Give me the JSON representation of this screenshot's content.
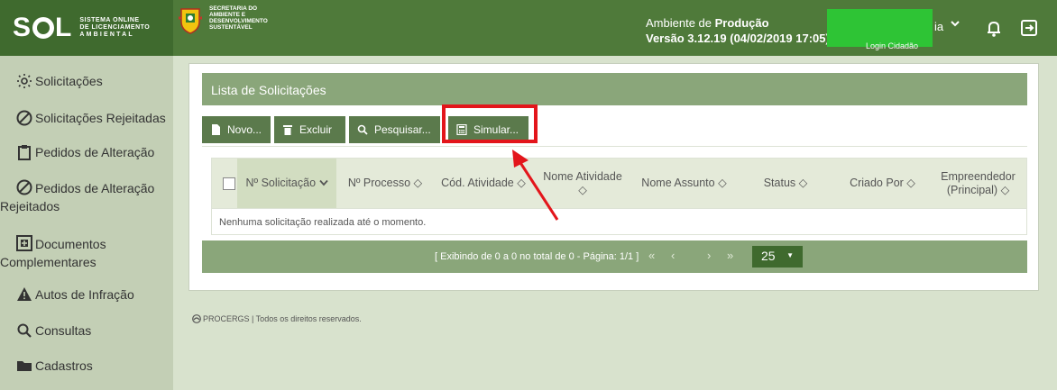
{
  "header": {
    "brand_sol": "SOL",
    "brand_line1": "SISTEMA ONLINE",
    "brand_line2": "DE LICENCIAMENTO",
    "brand_line3": "AMBIENTAL",
    "sec_line1": "SECRETARIA DO",
    "sec_line2": "AMBIENTE E",
    "sec_line3": "DESENVOLVIMENTO",
    "sec_line4": "SUSTENTÁVEL",
    "ambiente_prefix": "Ambiente de ",
    "ambiente_value": "Produção",
    "versao": "Versão 3.12.19 (04/02/2019 17:05)",
    "user_suffix": "ia",
    "login_label": "Login Cidadão"
  },
  "sidebar": {
    "items": [
      {
        "label": "Solicitações",
        "icon": "sun-icon"
      },
      {
        "label": "Solicitações Rejeitadas",
        "icon": "ban-icon"
      },
      {
        "label": "Pedidos de Alteração",
        "icon": "clipboard-icon"
      },
      {
        "label": "Pedidos de Alteração",
        "label2": "Rejeitados",
        "icon": "ban-icon"
      },
      {
        "label": "Documentos",
        "label2": "Complementares",
        "icon": "plus-square-icon"
      },
      {
        "label": "Autos de Infração",
        "icon": "warning-icon"
      },
      {
        "label": "Consultas",
        "icon": "search-icon"
      },
      {
        "label": "Cadastros",
        "icon": "folder-icon"
      }
    ]
  },
  "panel": {
    "title": "Lista de Solicitações"
  },
  "toolbar": {
    "novo": "Novo...",
    "excluir": "Excluir",
    "pesquisar": "Pesquisar...",
    "simular": "Simular..."
  },
  "table": {
    "columns": [
      {
        "label": "Nº Solicitação",
        "sort": "desc"
      },
      {
        "label": "Nº Processo",
        "sort": "both"
      },
      {
        "label": "Cód. Atividade",
        "sort": "both"
      },
      {
        "label": "Nome Atividade",
        "sort": "both"
      },
      {
        "label": "Nome Assunto",
        "sort": "both"
      },
      {
        "label": "Status",
        "sort": "both"
      },
      {
        "label": "Criado Por",
        "sort": "both"
      },
      {
        "label": "Empreendedor",
        "label2": "(Principal)",
        "sort": "both"
      }
    ],
    "empty_message": "Nenhuma solicitação realizada até o momento."
  },
  "pager": {
    "info": "[ Exibindo de 0 a 0 no total de 0 - Página: 1/1 ]",
    "first": "«",
    "prev": "‹",
    "next": "›",
    "last": "»",
    "page_size": "25"
  },
  "footer": {
    "text": "PROCERGS | Todos os direitos reservados."
  },
  "colors": {
    "header": "#4f7a3a",
    "sidebar": "#c3cfb5",
    "panel_head": "#8aa67a",
    "button": "#5b7a4c",
    "highlight": "#e3151b"
  }
}
